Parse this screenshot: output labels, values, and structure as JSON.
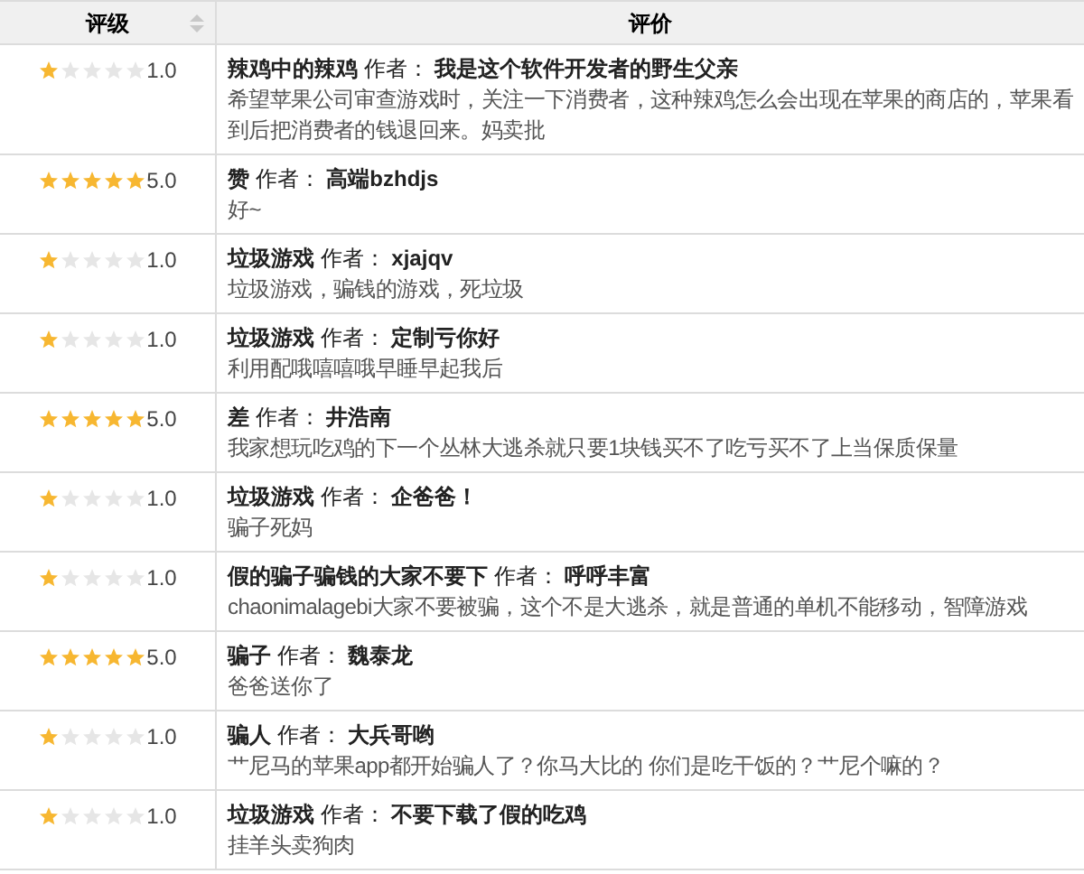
{
  "table": {
    "columns": [
      {
        "label": "评级",
        "sortable": true
      },
      {
        "label": "评价",
        "sortable": false
      }
    ],
    "rows": [
      {
        "stars": 1,
        "rating": "1.0",
        "heading": "**辣鸡中的辣鸡** 作者： **我是这个软件开发者的野生父亲**",
        "body": "希望苹果公司审查游戏时，关注一下消费者，这种辣鸡怎么会出现在苹果的商店的，苹果看到后把消费者的钱退回来。妈卖批"
      },
      {
        "stars": 5,
        "rating": "5.0",
        "heading": "**赞** 作者： **高端bzhdjs**",
        "body": "好~"
      },
      {
        "stars": 1,
        "rating": "1.0",
        "heading": "**垃圾游戏** 作者： **xjajqv**",
        "body": "垃圾游戏，骗钱的游戏，死垃圾"
      },
      {
        "stars": 1,
        "rating": "1.0",
        "heading": "**垃圾游戏** 作者： **定制亏你好**",
        "body": "利用配哦嘻嘻哦早睡早起我后"
      },
      {
        "stars": 5,
        "rating": "5.0",
        "heading": "**差** 作者： **井浩南**",
        "body": "我家想玩吃鸡的下一个丛林大逃杀就只要1块钱买不了吃亏买不了上当保质保量"
      },
      {
        "stars": 1,
        "rating": "1.0",
        "heading": "**垃圾游戏** 作者： **企爸爸！**",
        "body": "骗子死妈"
      },
      {
        "stars": 1,
        "rating": "1.0",
        "heading": "**假的骗子骗钱的大家不要下** 作者： **呼呼丰富**",
        "body": "chaonimalagebi大家不要被骗，这个不是大逃杀，就是普通的单机不能移动，智障游戏"
      },
      {
        "stars": 5,
        "rating": "5.0",
        "heading": "**骗子** 作者： **魏泰龙**",
        "body": "爸爸送你了"
      },
      {
        "stars": 1,
        "rating": "1.0",
        "heading": "**骗人** 作者： **大兵哥哟**",
        "body": "艹尼马的苹果app都开始骗人了？你马大比的 你们是吃干饭的？艹尼个嘛的？"
      },
      {
        "stars": 1,
        "rating": "1.0",
        "heading": "**垃圾游戏** 作者： **不要下载了假的吃鸡**",
        "body": "挂羊头卖狗肉"
      }
    ]
  }
}
